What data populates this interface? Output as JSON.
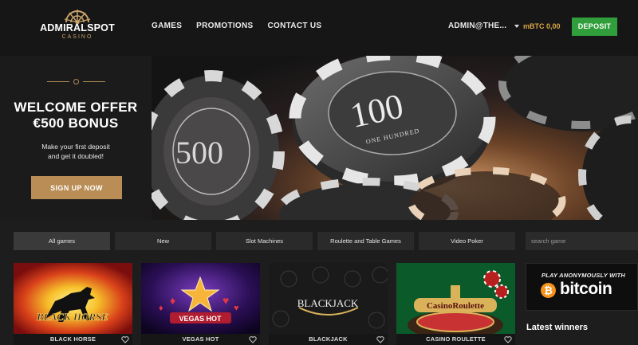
{
  "brand": {
    "name": "ADMIRALSPOT",
    "sub": "CASINO"
  },
  "nav": [
    {
      "label": "GAMES"
    },
    {
      "label": "PROMOTIONS"
    },
    {
      "label": "CONTACT US"
    }
  ],
  "account": {
    "user": "ADMIN@THE...",
    "balance": "mBTC 0,00",
    "deposit_label": "DEPOSIT"
  },
  "promo": {
    "title_line1": "WELCOME OFFER",
    "title_line2": "€500 BONUS",
    "text_line1": "Make your first deposit",
    "text_line2": "and get it doubled!",
    "cta": "SIGN UP NOW"
  },
  "hero": {
    "chip_100": "100",
    "chip_100_sub": "ONE HUNDRED",
    "chip_500": "500"
  },
  "filters": [
    {
      "label": "All games",
      "active": true
    },
    {
      "label": "New",
      "active": false
    },
    {
      "label": "Slot Machines",
      "active": false
    },
    {
      "label": "Roulette and Table Games",
      "active": false
    },
    {
      "label": "Video Poker",
      "active": false
    }
  ],
  "search": {
    "placeholder": "search game"
  },
  "games": [
    {
      "label": "BLACK HORSE",
      "art_text": "BLACK HORSE"
    },
    {
      "label": "VEGAS HOT",
      "art_text": "VEGAS HOT"
    },
    {
      "label": "BLACKJACK",
      "art_text": "BLACKJACK"
    },
    {
      "label": "CASINO ROULETTE",
      "art_text": "CasinoRoulette"
    }
  ],
  "sidebar": {
    "btc_top": "PLAY ANONYMOUSLY WITH",
    "btc_symbol": "₿",
    "btc_word": "bitcoin",
    "winners_title": "Latest winners"
  },
  "colors": {
    "accent_gold": "#b98d55",
    "deposit_green": "#2f9e3b",
    "btc_orange": "#f7931a"
  }
}
